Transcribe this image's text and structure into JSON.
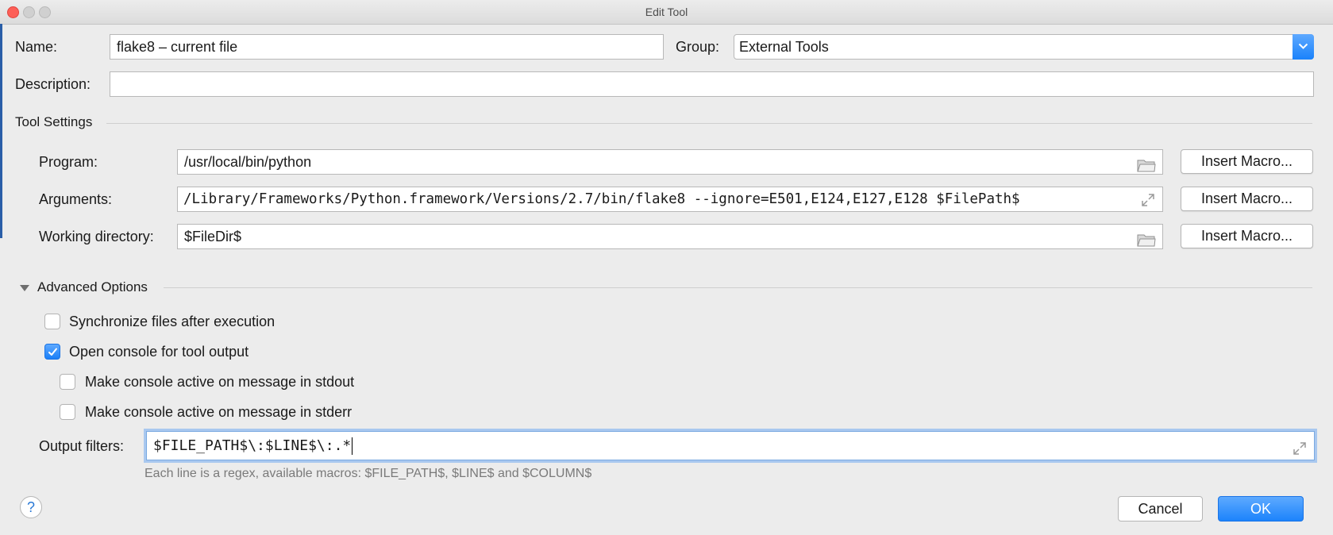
{
  "window": {
    "title": "Edit Tool"
  },
  "form": {
    "name_label": "Name:",
    "name_value": "flake8 – current file",
    "group_label": "Group:",
    "group_value": "External Tools",
    "description_label": "Description:",
    "description_value": ""
  },
  "tool_settings": {
    "title": "Tool Settings",
    "program_label": "Program:",
    "program_value": "/usr/local/bin/python",
    "arguments_label": "Arguments:",
    "arguments_value": "/Library/Frameworks/Python.framework/Versions/2.7/bin/flake8 --ignore=E501,E124,E127,E128 $FilePath$",
    "workdir_label": "Working directory:",
    "workdir_value": "$FileDir$",
    "insert_macro_label": "Insert Macro..."
  },
  "advanced": {
    "title": "Advanced Options",
    "checkboxes": [
      {
        "label": "Synchronize files after execution",
        "checked": false
      },
      {
        "label": "Open console for tool output",
        "checked": true
      },
      {
        "label": "Make console active on message in stdout",
        "checked": false
      },
      {
        "label": "Make console active on message in stderr",
        "checked": false
      }
    ],
    "output_filters_label": "Output filters:",
    "output_filters_value": "$FILE_PATH$\\:$LINE$\\:.*",
    "hint": "Each line is a regex, available macros: $FILE_PATH$, $LINE$ and $COLUMN$"
  },
  "footer": {
    "help_label": "?",
    "cancel_label": "Cancel",
    "ok_label": "OK"
  },
  "colors": {
    "accent": "#1c83fb",
    "background": "#ececec",
    "focus_ring": "#a9c8ef"
  },
  "icons": {
    "folder": "folder-icon",
    "expand": "expand-icon",
    "dropdown": "chevron-down-icon",
    "collapse": "triangle-down-icon",
    "check": "checkmark-icon"
  }
}
